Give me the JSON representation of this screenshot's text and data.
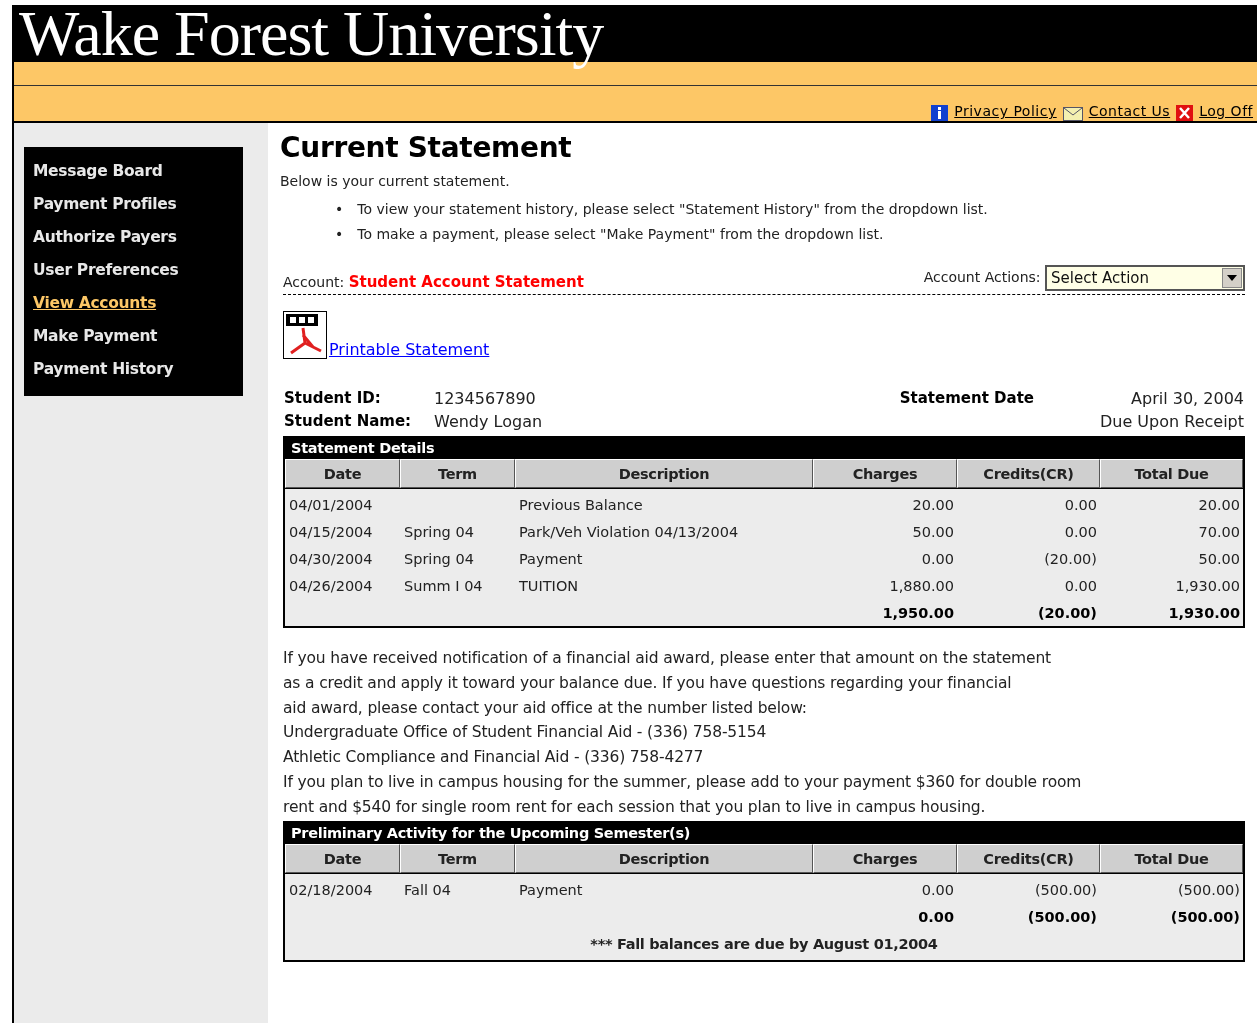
{
  "header": {
    "logo": "Wake Forest University",
    "links": [
      {
        "kind": "info",
        "label": "Privacy Policy"
      },
      {
        "kind": "mail",
        "label": "Contact Us"
      },
      {
        "kind": "close",
        "label": "Log Off"
      }
    ]
  },
  "sidebar": {
    "items": [
      {
        "label": "Message Board",
        "selected": false
      },
      {
        "label": "Payment Profiles",
        "selected": false
      },
      {
        "label": "Authorize Payers",
        "selected": false
      },
      {
        "label": "User Preferences",
        "selected": false
      },
      {
        "label": "View Accounts",
        "selected": true
      },
      {
        "label": "Make Payment",
        "selected": false
      },
      {
        "label": "Payment History",
        "selected": false
      }
    ]
  },
  "page": {
    "title": "Current Statement",
    "intro": "Below is your current statement.",
    "bullets": [
      {
        "marker": "•",
        "text": "To view your statement history, please select \"Statement History\" from the dropdown list."
      },
      {
        "marker": "•",
        "text": "To make a payment, please select \"Make Payment\" from the dropdown list."
      }
    ]
  },
  "account": {
    "label": "Account:",
    "value": "Student Account Statement",
    "actions_label": "Account Actions:",
    "actions_select": "Select Action"
  },
  "printable": {
    "label": "Printable Statement"
  },
  "student": {
    "id_label": "Student ID:",
    "id": "1234567890",
    "name_label": "Student Name:",
    "name": "Wendy Logan",
    "date_label": "Statement Date",
    "date": "April 30, 2004",
    "due": "Due Upon Receipt"
  },
  "statement_details": {
    "title": "Statement Details",
    "columns": [
      "Date",
      "Term",
      "Description",
      "Charges",
      "Credits(CR)",
      "Total Due"
    ],
    "rows": [
      {
        "date": "04/01/2004",
        "description": "Previous Balance",
        "charges": "20.00",
        "credits": "0.00",
        "total": "20.00"
      },
      {
        "date": "04/15/2004",
        "term": "Spring 04",
        "description": "Park/Veh Violation 04/13/2004",
        "charges": "50.00",
        "credits": "0.00",
        "total": "70.00"
      },
      {
        "date": "04/30/2004",
        "term": "Spring 04",
        "description": "Payment",
        "charges": "0.00",
        "credits": "(20.00)",
        "total": "50.00"
      },
      {
        "date": "04/26/2004",
        "term": "Summ I 04",
        "description": "TUITION",
        "charges": "1,880.00",
        "credits": "0.00",
        "total": "1,930.00"
      }
    ],
    "totals": {
      "charges": "1,950.00",
      "credits": "(20.00)",
      "total": "1,930.00"
    }
  },
  "notice": {
    "paragraphs": [
      {
        "lines": [
          "If you have received notification of a financial aid award, please enter that amount on the statement",
          "as a credit and apply it toward your balance due. If you have questions regarding your financial",
          "aid award, please contact your aid office at the number listed below:"
        ]
      },
      {
        "lines": [
          "Undergraduate Office of Student Financial Aid - (336) 758-5154"
        ]
      },
      {
        "lines": [
          "Athletic Compliance and Financial Aid - (336) 758-4277"
        ]
      },
      {
        "lines": [
          "If you plan to live in campus housing for the summer, please add to your payment $360 for double room",
          "rent and $540 for single room rent for each session that you plan to live in campus housing."
        ]
      }
    ]
  },
  "preliminary": {
    "title": "Preliminary Activity for the Upcoming Semester(s)",
    "columns": [
      "Date",
      "Term",
      "Description",
      "Charges",
      "Credits(CR)",
      "Total Due"
    ],
    "rows": [
      {
        "date": "02/18/2004",
        "term": "Fall 04",
        "description": "Payment",
        "charges": "0.00",
        "credits": "(500.00)",
        "total": "(500.00)"
      }
    ],
    "totals": {
      "charges": "0.00",
      "credits": "(500.00)",
      "total": "(500.00)"
    },
    "note": "*** Fall balances are due by August 01,2004"
  }
}
